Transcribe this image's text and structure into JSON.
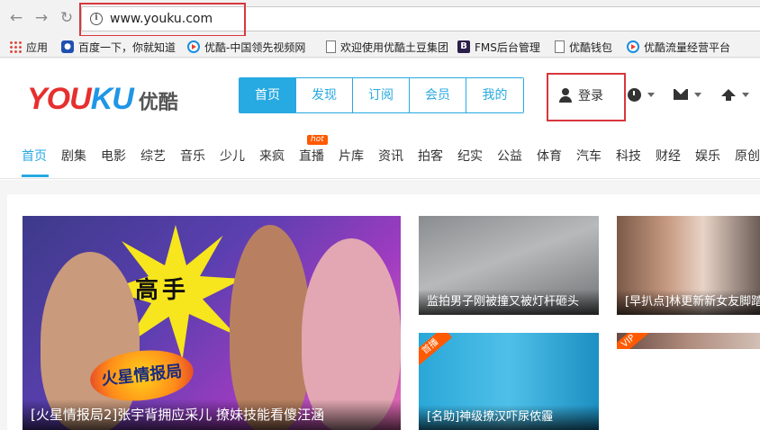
{
  "browser": {
    "url": "www.youku.com",
    "bookmarks": [
      {
        "label": "应用",
        "icon": "apps-grid-icon"
      },
      {
        "label": "百度一下，你就知道",
        "icon": "baidu-paw-icon"
      },
      {
        "label": "优酷-中国领先视频网",
        "icon": "youku-icon"
      },
      {
        "label": "欢迎使用优酷土豆集团",
        "icon": "document-icon"
      },
      {
        "label": "FMS后台管理",
        "icon": "b-icon"
      },
      {
        "label": "优酷钱包",
        "icon": "document-icon"
      },
      {
        "label": "优酷流量经营平台",
        "icon": "youku-icon"
      }
    ]
  },
  "header": {
    "logo_you": "YOU",
    "logo_ku": "KU",
    "logo_cn": "优酷",
    "main_tabs": [
      "首页",
      "发现",
      "订阅",
      "会员",
      "我的"
    ],
    "login_label": "登录"
  },
  "categories": {
    "items": [
      "首页",
      "剧集",
      "电影",
      "综艺",
      "音乐",
      "少儿",
      "来疯",
      "直播",
      "片库",
      "资讯",
      "拍客",
      "纪实",
      "公益",
      "体育",
      "汽车",
      "科技",
      "财经",
      "娱乐",
      "原创"
    ],
    "hot_badge": "hot"
  },
  "feed": {
    "big": {
      "title": "[火星情报局2]张宇背拥应采儿 撩妹技能看傻汪涵",
      "burst_text": "高手",
      "show_logo": "火星情报局"
    },
    "cards": [
      {
        "title": "监拍男子刚被撞又被灯杆砸头"
      },
      {
        "title": "[早扒点]林更新新女友脚踏三船"
      },
      {
        "title": "[名助]神级撩汉吓尿侬霾",
        "badge": "首播"
      },
      {
        "title": "",
        "badge": "VIP"
      }
    ]
  }
}
